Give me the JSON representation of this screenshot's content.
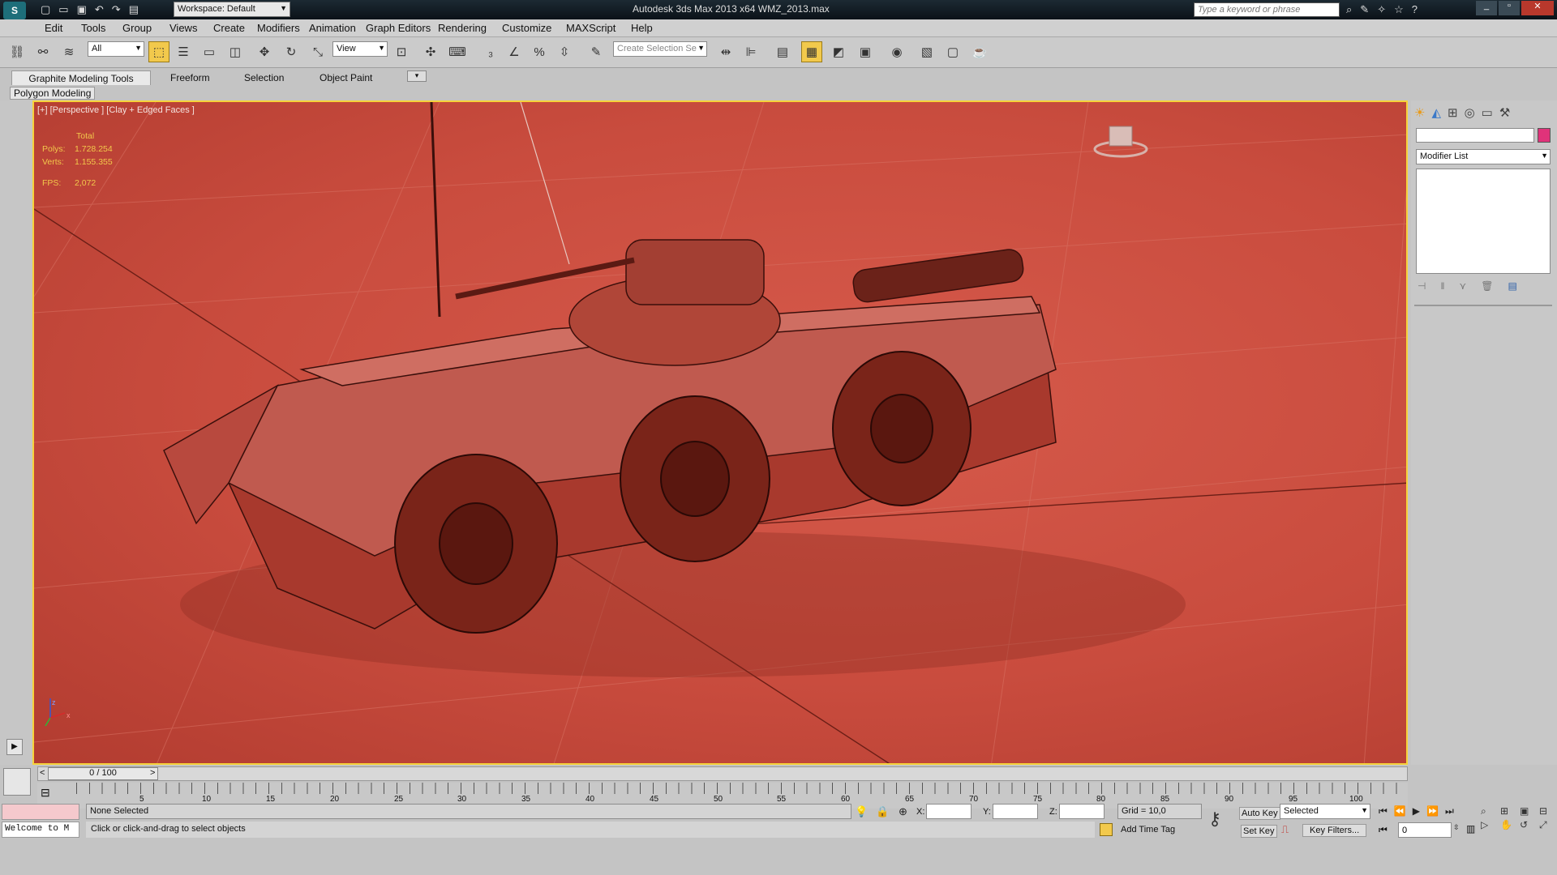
{
  "titlebar": {
    "workspace": "Workspace: Default",
    "title": "Autodesk 3ds Max  2013 x64      WMZ_2013.max",
    "search_placeholder": "Type a keyword or phrase"
  },
  "menu": [
    "Edit",
    "Tools",
    "Group",
    "Views",
    "Create",
    "Modifiers",
    "Animation",
    "Graph Editors",
    "Rendering",
    "Customize",
    "MAXScript",
    "Help"
  ],
  "toolbar": {
    "filter_value": "All",
    "refcoord_value": "View",
    "selection_set_placeholder": "Create Selection Se"
  },
  "ribbon": {
    "tabs": [
      "Graphite Modeling Tools",
      "Freeform",
      "Selection",
      "Object Paint"
    ],
    "sub_label": "Polygon Modeling"
  },
  "viewport": {
    "label": "[+] [Perspective ] [Clay + Edged Faces ]",
    "stats_total_label": "Total",
    "stats_polys_label": "Polys:",
    "stats_polys_value": "1.728.254",
    "stats_verts_label": "Verts:",
    "stats_verts_value": "1.155.355",
    "fps_label": "FPS:",
    "fps_value": "2,072",
    "axis_z": "z",
    "axis_x": "x",
    "colors": {
      "background": "#c94c3e",
      "border": "#f6d23b"
    }
  },
  "cmdpanel": {
    "modifier_list": "Modifier List",
    "color_swatch": "#e0337a"
  },
  "timeline": {
    "slider_label": "0 / 100",
    "ticks": [
      "5",
      "10",
      "15",
      "20",
      "25",
      "30",
      "35",
      "40",
      "45",
      "50",
      "55",
      "60",
      "65",
      "70",
      "75",
      "80",
      "85",
      "90",
      "95",
      "100"
    ]
  },
  "status": {
    "maxscript_text": "Welcome to M",
    "selection_status": "None Selected",
    "prompt": "Click or click-and-drag to select objects",
    "x_label": "X:",
    "y_label": "Y:",
    "z_label": "Z:",
    "grid": "Grid = 10,0",
    "add_time_tag": "Add Time Tag",
    "auto_key": "Auto Key",
    "set_key": "Set Key",
    "selected_dropdown": "Selected",
    "key_filters": "Key Filters...",
    "frame_value": "0"
  }
}
